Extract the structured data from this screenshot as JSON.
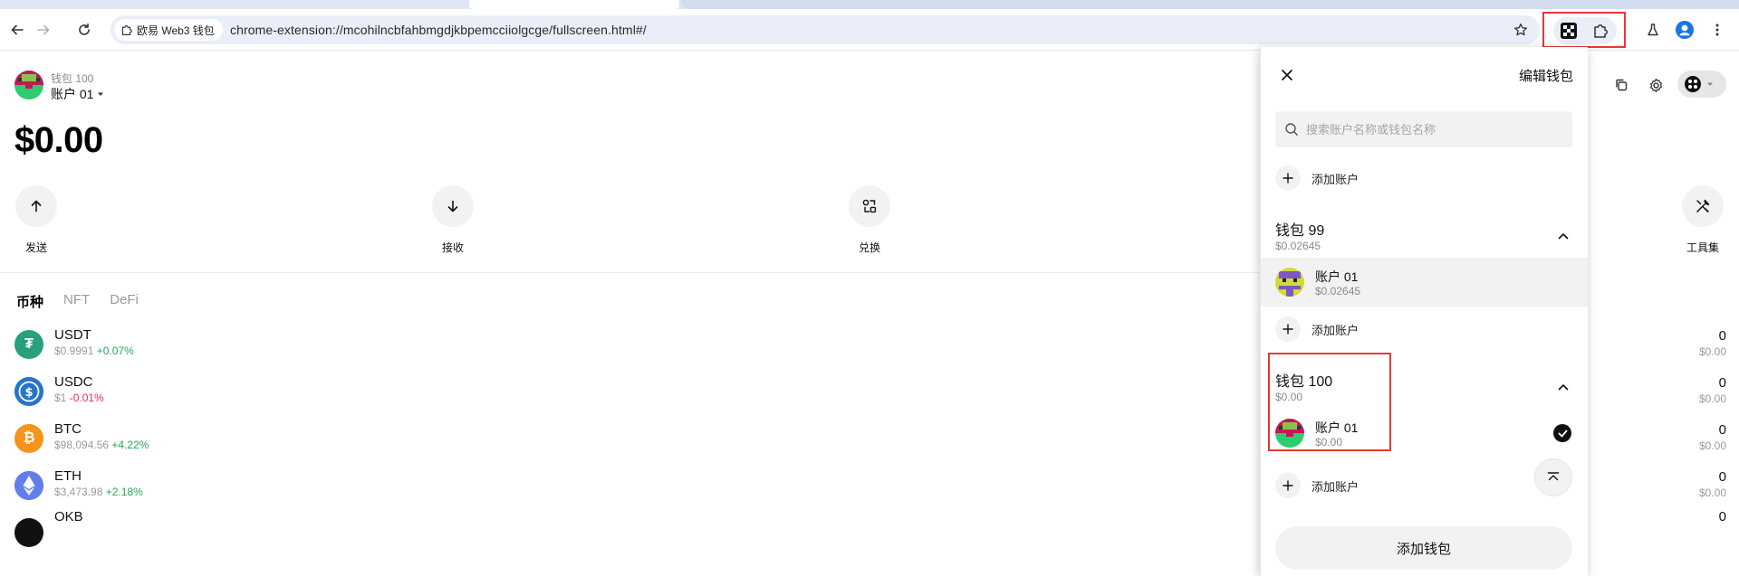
{
  "browser": {
    "site_chip": "欧易 Web3 钱包",
    "url": "chrome-extension://mcohilncbfahbmgdjkbpemcciiolgcge/fullscreen.html#/"
  },
  "header": {
    "wallet_name": "钱包 100",
    "account_name": "账户 01",
    "balance": "$0.00"
  },
  "actions": [
    {
      "label": "发送",
      "icon": "arrow-up-icon"
    },
    {
      "label": "接收",
      "icon": "arrow-down-icon"
    },
    {
      "label": "兑换",
      "icon": "swap-icon"
    },
    {
      "label": "工具集",
      "icon": "tools-icon"
    }
  ],
  "tabs": [
    {
      "label": "币种",
      "active": true
    },
    {
      "label": "NFT",
      "active": false
    },
    {
      "label": "DeFi",
      "active": false
    }
  ],
  "tokens": [
    {
      "symbol": "USDT",
      "price": "$0.9991",
      "change": "+0.07%",
      "dir": "up",
      "amount": "0",
      "value": "$0.00",
      "color": "#26a17b"
    },
    {
      "symbol": "USDC",
      "price": "$1",
      "change": "-0.01%",
      "dir": "down",
      "amount": "0",
      "value": "$0.00",
      "color": "#2775ca"
    },
    {
      "symbol": "BTC",
      "price": "$98,094.56",
      "change": "+4.22%",
      "dir": "up",
      "amount": "0",
      "value": "$0.00",
      "color": "#f7931a"
    },
    {
      "symbol": "ETH",
      "price": "$3,473.98",
      "change": "+2.18%",
      "dir": "up",
      "amount": "0",
      "value": "$0.00",
      "color": "#627eea"
    },
    {
      "symbol": "OKB",
      "price": "",
      "change": "",
      "dir": "up",
      "amount": "0",
      "value": "",
      "color": "#111111"
    }
  ],
  "drawer": {
    "title": "编辑钱包",
    "search_placeholder": "搜索账户名称或钱包名称",
    "add_account_label": "添加账户",
    "groups": [
      {
        "name": "钱包 99",
        "balance": "$0.02645",
        "accounts": [
          {
            "name": "账户 01",
            "balance": "$0.02645"
          }
        ]
      },
      {
        "name": "钱包 100",
        "balance": "$0.00",
        "accounts": [
          {
            "name": "账户 01",
            "balance": "$0.00"
          }
        ]
      }
    ],
    "add_wallet_label": "添加钱包"
  }
}
